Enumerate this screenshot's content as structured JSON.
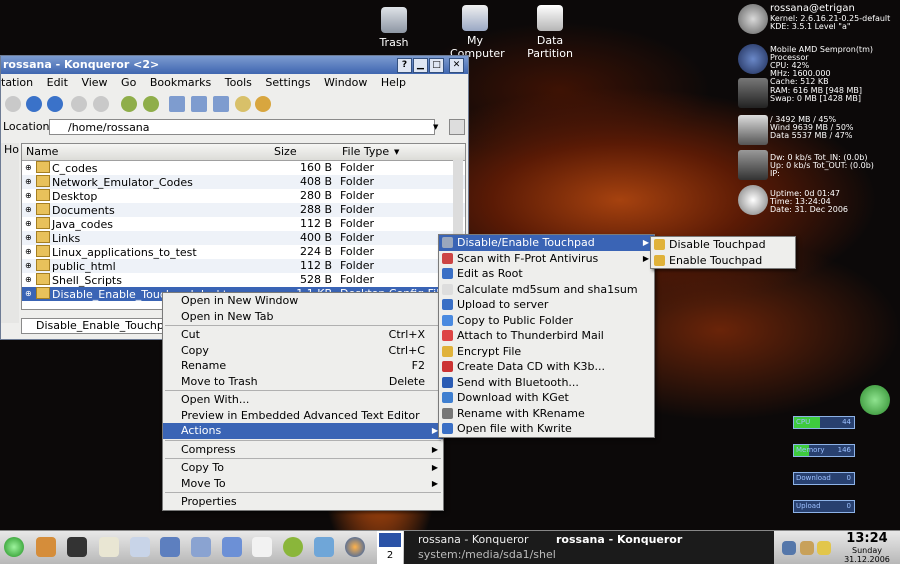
{
  "desktop": {
    "icons": [
      {
        "label": "Trash"
      },
      {
        "label": "My Computer"
      },
      {
        "label": "Data Partition"
      }
    ]
  },
  "window": {
    "title": "rossana - Konqueror <2>",
    "controls": [
      "?",
      "▁",
      "□",
      "✕"
    ],
    "menus": [
      "tation",
      "Edit",
      "View",
      "Go",
      "Bookmarks",
      "Tools",
      "Settings",
      "Window",
      "Help"
    ],
    "location_label": "Location:",
    "location_value": "/home/rossana",
    "columns": [
      "Name",
      "Size",
      "File Type"
    ],
    "files": [
      {
        "name": "C_codes",
        "size": "160 B",
        "type": "Folder"
      },
      {
        "name": "Network_Emulator_Codes",
        "size": "408 B",
        "type": "Folder"
      },
      {
        "name": "Desktop",
        "size": "280 B",
        "type": "Folder"
      },
      {
        "name": "Documents",
        "size": "288 B",
        "type": "Folder"
      },
      {
        "name": "Java_codes",
        "size": "112 B",
        "type": "Folder"
      },
      {
        "name": "Links",
        "size": "400 B",
        "type": "Folder"
      },
      {
        "name": "Linux_applications_to_test",
        "size": "224 B",
        "type": "Folder"
      },
      {
        "name": "public_html",
        "size": "112 B",
        "type": "Folder"
      },
      {
        "name": "Shell_Scripts",
        "size": "528 B",
        "type": "Folder"
      },
      {
        "name": "Disable_Enable_Touchpad.desktop",
        "size": "1.1 KB",
        "type": "Desktop Config File"
      }
    ],
    "status": "Disable_Enable_Touchpad.",
    "sidebar_label": "Ho"
  },
  "context_menu": [
    {
      "label": "Open in New Window"
    },
    {
      "label": "Open in New Tab"
    },
    {
      "sep": true
    },
    {
      "label": "Cut",
      "shortcut": "Ctrl+X"
    },
    {
      "label": "Copy",
      "shortcut": "Ctrl+C"
    },
    {
      "label": "Rename",
      "shortcut": "F2"
    },
    {
      "label": "Move to Trash",
      "shortcut": "Delete"
    },
    {
      "sep": true
    },
    {
      "label": "Open With..."
    },
    {
      "label": "Preview in Embedded Advanced Text Editor"
    },
    {
      "label": "Actions",
      "submenu": true,
      "highlight": true
    },
    {
      "sep": true
    },
    {
      "label": "Compress",
      "submenu": true
    },
    {
      "sep": true
    },
    {
      "label": "Copy To",
      "submenu": true
    },
    {
      "label": "Move To",
      "submenu": true
    },
    {
      "sep": true
    },
    {
      "label": "Properties"
    }
  ],
  "actions_menu": [
    {
      "label": "Disable/Enable Touchpad",
      "submenu": true,
      "highlight": true
    },
    {
      "label": "Scan with F-Prot Antivirus",
      "submenu": true
    },
    {
      "label": "Edit as Root"
    },
    {
      "label": "Calculate md5sum and sha1sum"
    },
    {
      "label": "Upload to server"
    },
    {
      "label": "Copy to Public Folder"
    },
    {
      "label": "Attach to Thunderbird Mail"
    },
    {
      "label": "Encrypt File"
    },
    {
      "label": "Create Data CD with K3b..."
    },
    {
      "label": "Send with Bluetooth..."
    },
    {
      "label": "Download with KGet"
    },
    {
      "label": "Rename with KRename"
    },
    {
      "label": "Open file with Kwrite"
    }
  ],
  "touchpad_menu": [
    {
      "label": "Disable Touchpad"
    },
    {
      "label": "Enable Touchpad"
    }
  ],
  "sysinfo": {
    "user": "rossana@etrigan",
    "kernel": "Kernel:  2.6.16.21-0.25-default",
    "kde": "KDE:     3.5.1 Level \"a\"",
    "cpu1": "Mobile AMD Sempron(tm) Processor",
    "cpu2": "CPU:     42%",
    "cpu3": "MHz:     1600.000",
    "cpu4": "Cache:   512 KB",
    "ram": "RAM:    616 MB  [948 MB]",
    "swap": "Swap:   0 MB    [1428 MB]",
    "disk1": "/        3492 MB / 45%",
    "disk2": "Wind    9639 MB / 50%",
    "disk3": "Data    5537 MB / 47%",
    "net1": "Dw:  0 kb/s  Tot_IN:   (0.0b)",
    "net2": "Up:  0 kb/s  Tot_OUT:  (0.0b)",
    "net3": "IP:",
    "up1": "Uptime: 0d 01:47",
    "up2": "Time:   13:24:04",
    "up3": "Date:   31. Dec 2006",
    "bars": [
      {
        "label": "CPU",
        "value": "44",
        "fill": 0.44
      },
      {
        "label": "Memory",
        "value": "146",
        "fill": 0.25
      },
      {
        "label": "Download",
        "value": "0",
        "fill": 0
      },
      {
        "label": "Upload",
        "value": "0",
        "fill": 0
      }
    ]
  },
  "taskbar": {
    "desktop_number": "2",
    "tasks": [
      "rossana - Konqueror",
      "rossana - Konqueror",
      "system:/media/sda1/shel"
    ],
    "time": "13:24",
    "day": "Sunday",
    "date": "31.12.2006"
  },
  "colors": {
    "accent": "#3a64b5",
    "title": "#3f66b0",
    "panel": "#d4d4d4"
  }
}
